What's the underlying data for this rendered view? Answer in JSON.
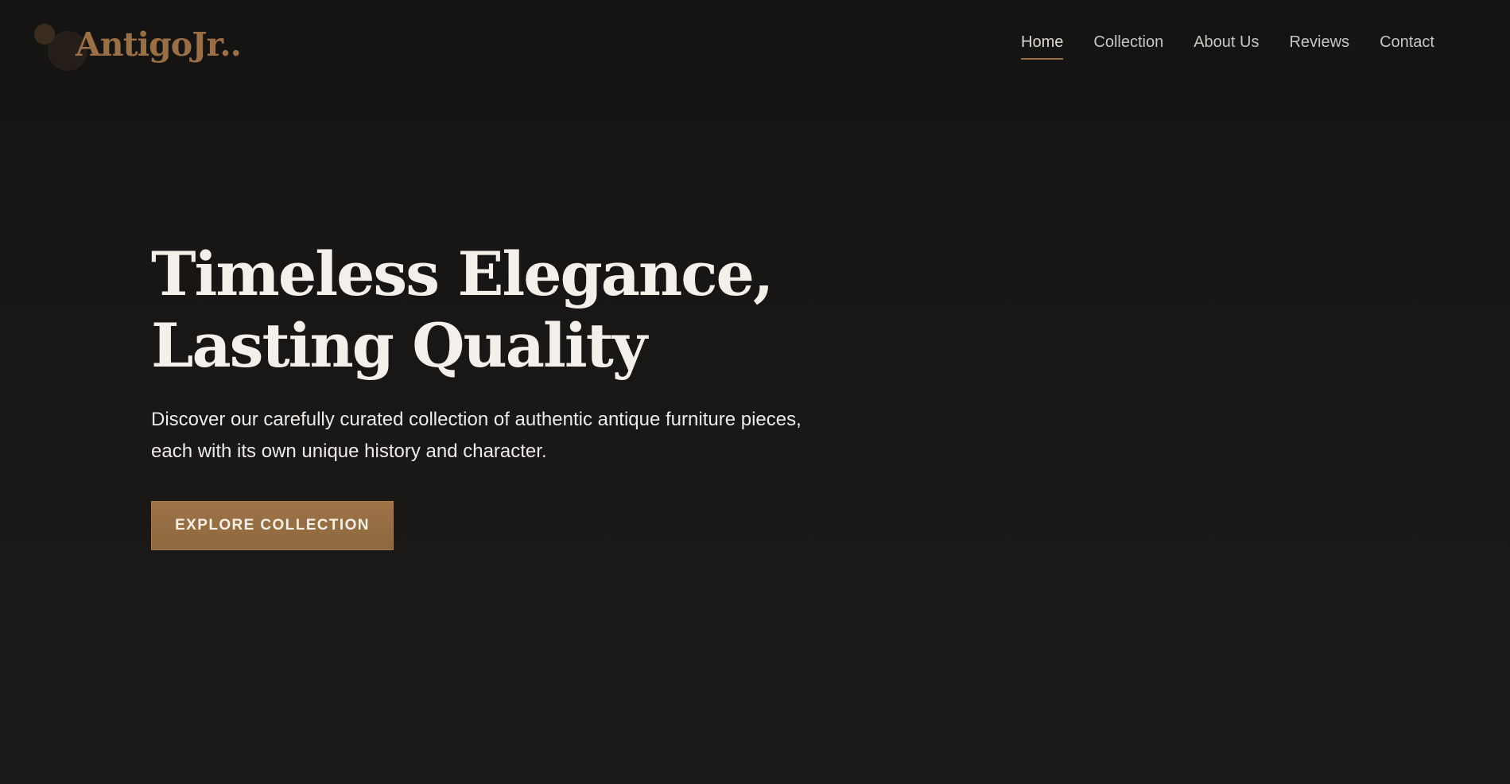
{
  "header": {
    "logo_text": "AntigoJr..",
    "nav": [
      {
        "label": "Home",
        "active": true
      },
      {
        "label": "Collection",
        "active": false
      },
      {
        "label": "About Us",
        "active": false
      },
      {
        "label": "Reviews",
        "active": false
      },
      {
        "label": "Contact",
        "active": false
      }
    ]
  },
  "hero": {
    "title_line1": "Timeless Elegance,",
    "title_line2": "Lasting Quality",
    "subtitle_line1": "Discover our carefully curated collection of authentic antique furniture pieces,",
    "subtitle_line2": "each with its own unique history and character.",
    "cta_label": "EXPLORE COLLECTION"
  },
  "colors": {
    "background": "#181716",
    "accent": "#9a6f45",
    "text_primary": "#f3f0ea",
    "nav_text": "#c9c6c1"
  }
}
